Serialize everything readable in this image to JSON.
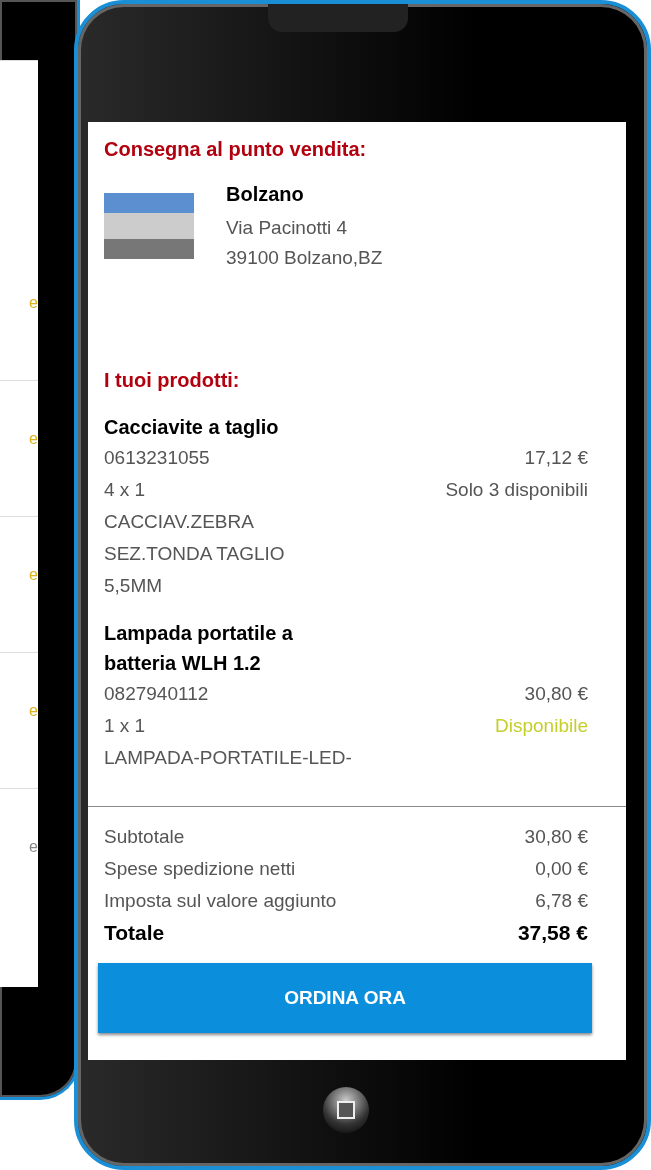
{
  "left_phone": {
    "rows": [
      {
        "text": "e",
        "available": true
      },
      {
        "text": "e",
        "available": true
      },
      {
        "text": "e",
        "available": true
      },
      {
        "text": "e",
        "available": true
      },
      {
        "text": "e",
        "available": false
      }
    ]
  },
  "delivery": {
    "heading": "Consegna al punto vendita:",
    "store": {
      "name": "Bolzano",
      "street": "Via Pacinotti 4",
      "city": "39100 Bolzano,BZ"
    }
  },
  "products": {
    "heading": "I tuoi prodotti:",
    "items": [
      {
        "name": "Cacciavite a taglio",
        "code": "0613231055",
        "quantity": "4 x 1",
        "description_lines": [
          "CACCIAV.ZEBRA",
          "SEZ.TONDA TAGLIO",
          "5,5MM"
        ],
        "price": "17,12 €",
        "availability": "Solo 3 disponibili",
        "limited_stock": true
      },
      {
        "name": "Lampada portatile a batteria WLH 1.2",
        "code": "0827940112",
        "quantity": "1 x 1",
        "description_lines": [
          "LAMPADA-PORTATILE-LED-"
        ],
        "price": "30,80 €",
        "availability": "Disponibile",
        "limited_stock": false
      }
    ]
  },
  "totals": [
    {
      "label": "Subtotale",
      "value": "30,80 €",
      "kind": "line"
    },
    {
      "label": "Spese spedizione netti",
      "value": "0,00 €",
      "kind": "line"
    },
    {
      "label": "Imposta sul valore aggiunto",
      "value": "6,78 €",
      "kind": "line"
    },
    {
      "label": "Totale",
      "value": "37,58 €",
      "kind": "total"
    }
  ],
  "order_button": "ORDINA ORA"
}
